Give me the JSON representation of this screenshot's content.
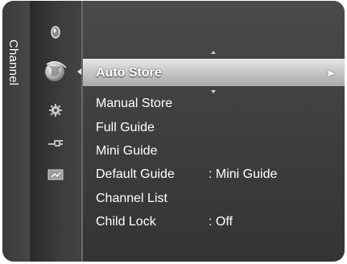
{
  "menu": {
    "section_title": "Channel",
    "icons": [
      {
        "name": "picture-icon"
      },
      {
        "name": "channel-icon"
      },
      {
        "name": "setup-icon"
      },
      {
        "name": "input-icon"
      },
      {
        "name": "application-icon"
      }
    ],
    "items": [
      {
        "label": "Auto Store",
        "value": "",
        "selected": true,
        "arrow": "►"
      },
      {
        "label": "Manual Store",
        "value": ""
      },
      {
        "label": "Full Guide",
        "value": ""
      },
      {
        "label": "Mini Guide",
        "value": ""
      },
      {
        "label": "Default Guide",
        "value": ": Mini Guide"
      },
      {
        "label": "Channel List",
        "value": ""
      },
      {
        "label": "Child Lock",
        "value": ": Off"
      }
    ]
  }
}
